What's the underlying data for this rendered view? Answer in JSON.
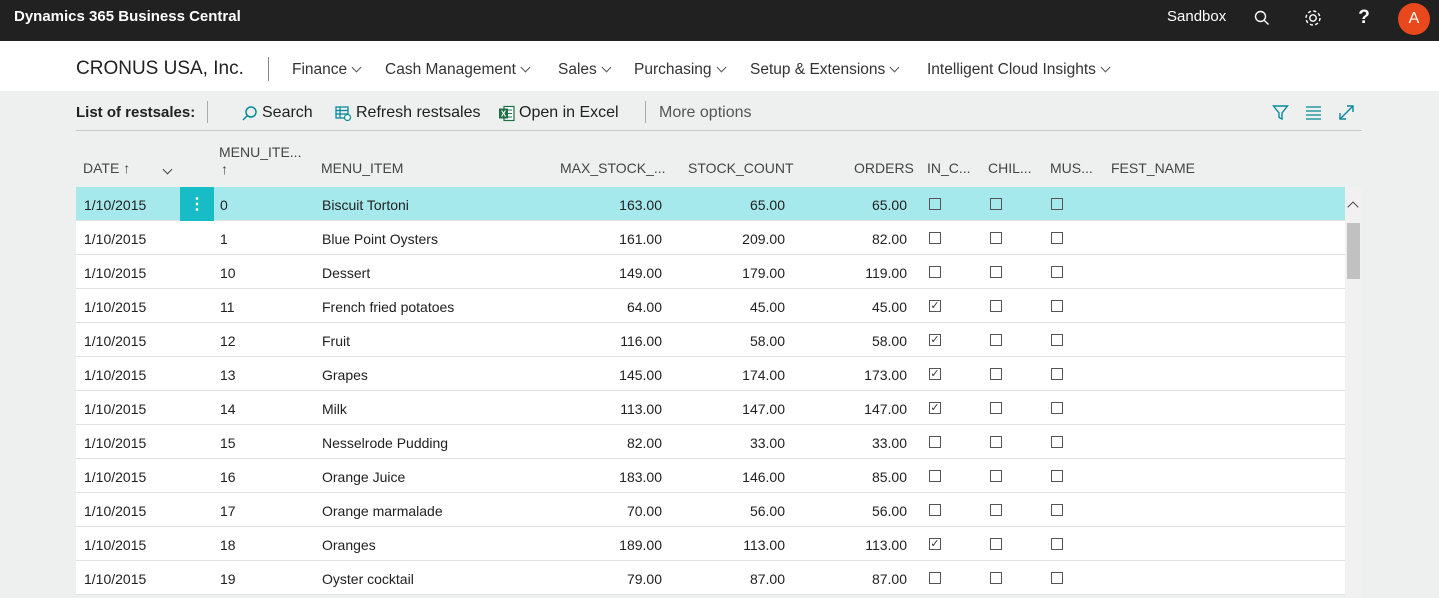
{
  "topbar": {
    "app_title": "Dynamics 365 Business Central",
    "environment": "Sandbox",
    "search_icon": "search-icon",
    "settings_icon": "gear-icon",
    "help_icon": "help-icon",
    "avatar_letter": "A",
    "avatar_color": "#e8481b"
  },
  "nav": {
    "company": "CRONUS USA, Inc.",
    "menus": [
      "Finance",
      "Cash Management",
      "Sales",
      "Purchasing",
      "Setup & Extensions",
      "Intelligent Cloud Insights"
    ]
  },
  "actionbar": {
    "title": "List of restsales:",
    "search": "Search",
    "refresh": "Refresh restsales",
    "excel": "Open in Excel",
    "more": "More options",
    "accent": "#0a8a99"
  },
  "columns": {
    "date": "DATE",
    "menu_item_no_line1": "MENU_ITE...",
    "menu_item_no_arrow": "↑",
    "date_arrow": "↑",
    "menu_item": "MENU_ITEM",
    "max_stock": "MAX_STOCK_...",
    "stock_count": "STOCK_COUNT",
    "orders": "ORDERS",
    "in_c": "IN_C...",
    "chil": "CHIL...",
    "mus": "MUS...",
    "fest_name": "FEST_NAME"
  },
  "rows": [
    {
      "date": "1/10/2015",
      "no": "0",
      "item": "Biscuit Tortoni",
      "max": "163.00",
      "stock": "65.00",
      "orders": "65.00",
      "in_c": false,
      "chil": false,
      "mus": false
    },
    {
      "date": "1/10/2015",
      "no": "1",
      "item": "Blue Point Oysters",
      "max": "161.00",
      "stock": "209.00",
      "orders": "82.00",
      "in_c": false,
      "chil": false,
      "mus": false
    },
    {
      "date": "1/10/2015",
      "no": "10",
      "item": "Dessert",
      "max": "149.00",
      "stock": "179.00",
      "orders": "119.00",
      "in_c": false,
      "chil": false,
      "mus": false
    },
    {
      "date": "1/10/2015",
      "no": "11",
      "item": "French fried potatoes",
      "max": "64.00",
      "stock": "45.00",
      "orders": "45.00",
      "in_c": true,
      "chil": false,
      "mus": false
    },
    {
      "date": "1/10/2015",
      "no": "12",
      "item": "Fruit",
      "max": "116.00",
      "stock": "58.00",
      "orders": "58.00",
      "in_c": true,
      "chil": false,
      "mus": false
    },
    {
      "date": "1/10/2015",
      "no": "13",
      "item": "Grapes",
      "max": "145.00",
      "stock": "174.00",
      "orders": "173.00",
      "in_c": true,
      "chil": false,
      "mus": false
    },
    {
      "date": "1/10/2015",
      "no": "14",
      "item": "Milk",
      "max": "113.00",
      "stock": "147.00",
      "orders": "147.00",
      "in_c": true,
      "chil": false,
      "mus": false
    },
    {
      "date": "1/10/2015",
      "no": "15",
      "item": "Nesselrode Pudding",
      "max": "82.00",
      "stock": "33.00",
      "orders": "33.00",
      "in_c": false,
      "chil": false,
      "mus": false
    },
    {
      "date": "1/10/2015",
      "no": "16",
      "item": "Orange Juice",
      "max": "183.00",
      "stock": "146.00",
      "orders": "85.00",
      "in_c": false,
      "chil": false,
      "mus": false
    },
    {
      "date": "1/10/2015",
      "no": "17",
      "item": "Orange marmalade",
      "max": "70.00",
      "stock": "56.00",
      "orders": "56.00",
      "in_c": false,
      "chil": false,
      "mus": false
    },
    {
      "date": "1/10/2015",
      "no": "18",
      "item": "Oranges",
      "max": "189.00",
      "stock": "113.00",
      "orders": "113.00",
      "in_c": true,
      "chil": false,
      "mus": false
    },
    {
      "date": "1/10/2015",
      "no": "19",
      "item": "Oyster cocktail",
      "max": "79.00",
      "stock": "87.00",
      "orders": "87.00",
      "in_c": false,
      "chil": false,
      "mus": false
    }
  ],
  "selected_row": 0
}
